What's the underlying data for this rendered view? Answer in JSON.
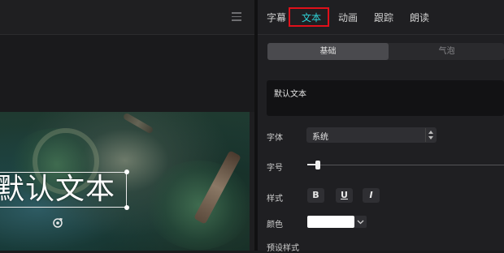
{
  "preview": {
    "caption": "默认文本"
  },
  "inspector": {
    "tabs": [
      {
        "label": "字幕"
      },
      {
        "label": "文本",
        "active": true
      },
      {
        "label": "动画"
      },
      {
        "label": "跟踪"
      },
      {
        "label": "朗读"
      }
    ],
    "segments": {
      "basic": "基础",
      "bubble": "气泡",
      "selected": "基础"
    },
    "text_area_value": "默认文本",
    "font": {
      "label": "字体",
      "value": "系统"
    },
    "size": {
      "label": "字号",
      "slider_fraction": 0.05
    },
    "style": {
      "label": "样式",
      "bold": "B",
      "underline": "U",
      "italic": "I"
    },
    "color": {
      "label": "颜色",
      "value": "#ffffff"
    },
    "preset": {
      "label": "预设样式"
    }
  },
  "colors": {
    "accent": "#2fd3d8",
    "highlight_box": "#e0101a",
    "panel_bg": "#1f1f22"
  }
}
